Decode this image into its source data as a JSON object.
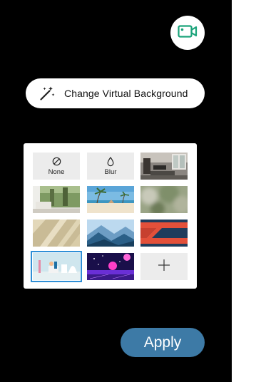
{
  "camera_button": {
    "icon": "video-camera-icon"
  },
  "change_background": {
    "icon": "magic-wand-icon",
    "label": "Change Virtual Background"
  },
  "backgrounds": {
    "none_option": {
      "icon": "no-symbol-icon",
      "label": "None"
    },
    "blur_option": {
      "icon": "droplet-icon",
      "label": "Blur"
    },
    "images": [
      "living-room-interior",
      "room-with-forest-view",
      "beach-with-palms",
      "blurred-greenery",
      "sunlit-blinds-wall",
      "blue-mountains",
      "red-orange-stripes",
      "pastel-3d-scene",
      "purple-space-scene"
    ],
    "selected": "pastel-3d-scene",
    "add_option": {
      "icon": "plus-icon"
    }
  },
  "apply_button": {
    "label": "Apply"
  },
  "colors": {
    "panel": "#000000",
    "apply": "#3d7aa6",
    "selection": "#2f8fd6",
    "camera_icon": "#1aa37a"
  }
}
